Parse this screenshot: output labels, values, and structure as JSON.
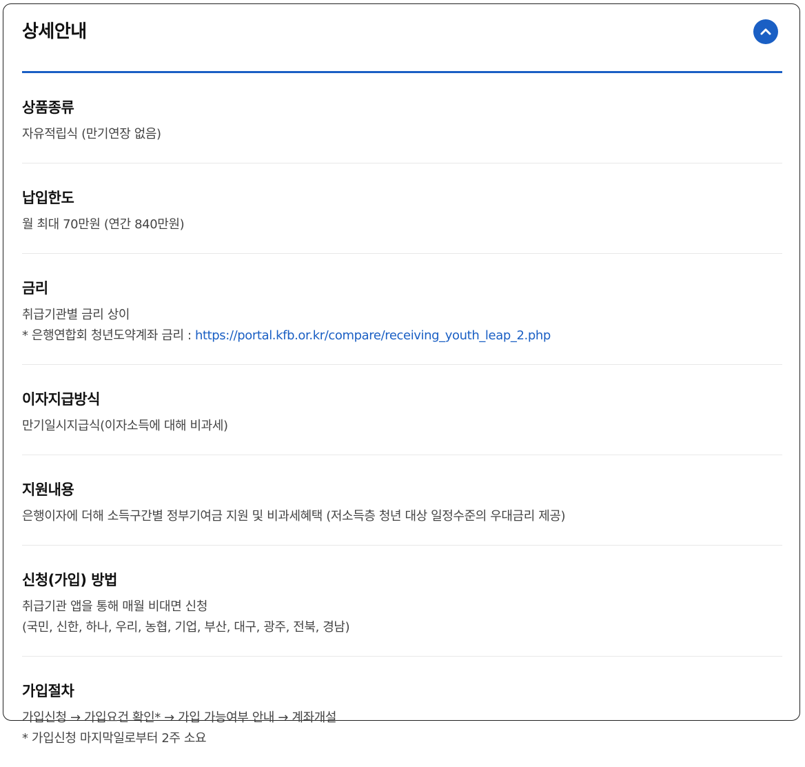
{
  "header": {
    "title": "상세안내",
    "toggle_icon": "chevron-up-icon"
  },
  "colors": {
    "accent": "#1a5fc4",
    "title": "#111111",
    "body": "#444444",
    "divider": "#e8e8e8"
  },
  "sections": [
    {
      "title": "상품종류",
      "lines": [
        "자유적립식 (만기연장 없음)"
      ]
    },
    {
      "title": "납입한도",
      "lines": [
        "월 최대 70만원 (연간 840만원)"
      ]
    },
    {
      "title": "금리",
      "lines": [
        "취급기관별 금리 상이"
      ],
      "note_prefix": "* 은행연합회 청년도약계좌 금리 : ",
      "link": "https://portal.kfb.or.kr/compare/receiving_youth_leap_2.php"
    },
    {
      "title": "이자지급방식",
      "lines": [
        "만기일시지급식(이자소득에 대해 비과세)"
      ]
    },
    {
      "title": "지원내용",
      "lines": [
        "은행이자에 더해 소득구간별 정부기여금 지원 및 비과세혜택 (저소득층 청년 대상 일정수준의 우대금리 제공)"
      ]
    },
    {
      "title": "신청(가입) 방법",
      "lines": [
        "취급기관 앱을 통해 매월 비대면 신청",
        "(국민, 신한, 하나, 우리, 농협, 기업, 부산, 대구, 광주, 전북, 경남)"
      ]
    },
    {
      "title": "가입절차",
      "lines": [
        "가입신청 → 가입요건 확인* → 가입 가능여부 안내 → 계좌개설",
        "* 가입신청 마지막일로부터 2주 소요"
      ]
    }
  ]
}
